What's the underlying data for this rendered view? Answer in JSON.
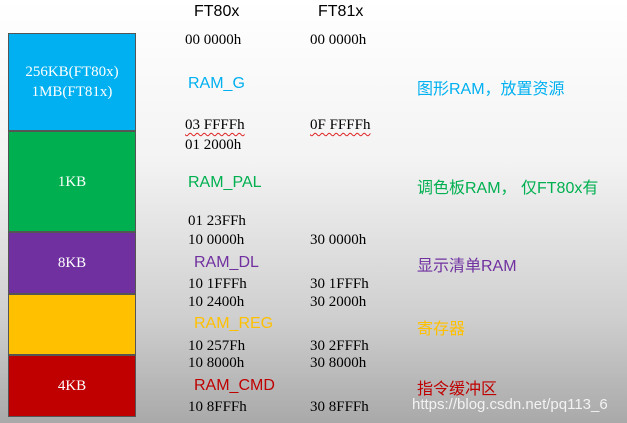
{
  "headers": {
    "ft80x": "FT80x",
    "ft81x": "FT81x"
  },
  "colors": {
    "ram_g": "#00b0f0",
    "ram_pal": "#00b050",
    "ram_dl": "#7030a0",
    "ram_reg": "#ffc000",
    "ram_cmd": "#c00000"
  },
  "regions": [
    {
      "name": "RAM_G",
      "size_label_line1": "256KB(FT80x)",
      "size_label_line2": "1MB(FT81x)",
      "description": "图形RAM，放置资源",
      "ft80x_start": "00 0000h",
      "ft81x_start": "00 0000h",
      "ft80x_end": "03 FFFFh",
      "ft81x_end": "0F FFFFh"
    },
    {
      "name": "RAM_PAL",
      "size_label": "1KB",
      "description": "调色板RAM， 仅FT80x有",
      "ft80x_start": "01 2000h",
      "ft80x_end": "01 23FFh"
    },
    {
      "name": "RAM_DL",
      "size_label": "8KB",
      "description": "显示清单RAM",
      "ft80x_start": "10 0000h",
      "ft81x_start": "30 0000h",
      "ft80x_end": "10 1FFFh",
      "ft81x_end": "30 1FFFh"
    },
    {
      "name": "RAM_REG",
      "size_label": "",
      "description": "寄存器",
      "ft80x_start": "10 2400h",
      "ft81x_start": "30 2000h",
      "ft80x_end": "10 257Fh",
      "ft81x_end": "30 2FFFh"
    },
    {
      "name": "RAM_CMD",
      "size_label": "4KB",
      "description": "指令缓冲区",
      "ft80x_start": "10 8000h",
      "ft81x_start": "30 8000h",
      "ft80x_end": "10 8FFFh",
      "ft81x_end": "30 8FFFh"
    }
  ],
  "watermark": "https://blog.csdn.net/pq113_6"
}
